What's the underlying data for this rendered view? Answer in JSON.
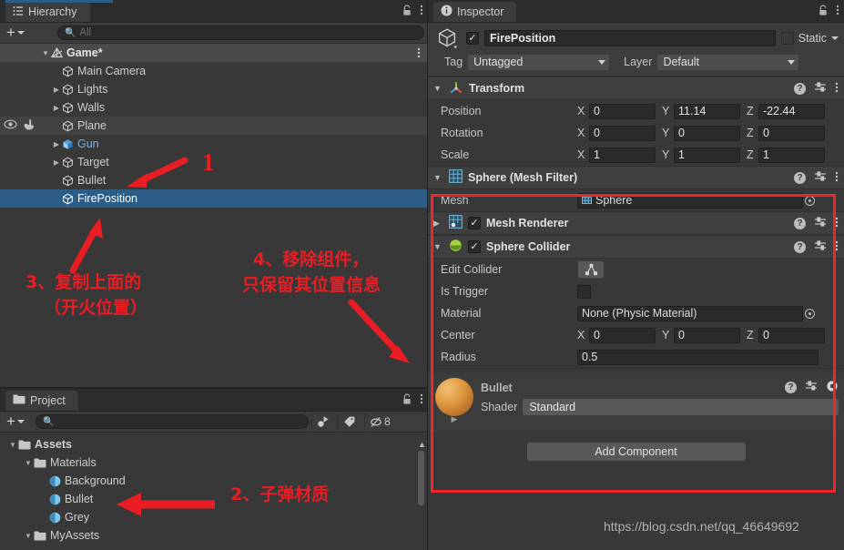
{
  "hierarchy": {
    "tab_label": "Hierarchy",
    "tab_icon": "hierarchy-list-icon",
    "create_label": "+",
    "search_placeholder": "All",
    "scene": {
      "name": "Game*",
      "icon": "unity-scene-icon"
    },
    "items": [
      {
        "label": "Main Camera",
        "indent": 2,
        "expandable": false,
        "selected": false,
        "hover": false,
        "blue": false
      },
      {
        "label": "Lights",
        "indent": 2,
        "expandable": true,
        "selected": false,
        "hover": false,
        "blue": false
      },
      {
        "label": "Walls",
        "indent": 2,
        "expandable": true,
        "selected": false,
        "hover": false,
        "blue": false
      },
      {
        "label": "Plane",
        "indent": 2,
        "expandable": false,
        "selected": false,
        "hover": true,
        "blue": false
      },
      {
        "label": "Gun",
        "indent": 2,
        "expandable": true,
        "selected": false,
        "hover": false,
        "blue": true
      },
      {
        "label": "Target",
        "indent": 2,
        "expandable": true,
        "selected": false,
        "hover": false,
        "blue": false
      },
      {
        "label": "Bullet",
        "indent": 2,
        "expandable": false,
        "selected": false,
        "hover": false,
        "blue": false
      },
      {
        "label": "FirePosition",
        "indent": 2,
        "expandable": false,
        "selected": true,
        "hover": false,
        "blue": false
      }
    ]
  },
  "project": {
    "tab_label": "Project",
    "tab_icon": "folder-icon",
    "create_label": "+",
    "search_placeholder": "",
    "tool_icons": [
      "favorites-icon",
      "label-icon",
      "hidden-packages-icon"
    ],
    "hidden_count": "8",
    "items": [
      {
        "label": "Assets",
        "indent": 0,
        "type": "folder",
        "expanded": true
      },
      {
        "label": "Materials",
        "indent": 1,
        "type": "folder",
        "expanded": true
      },
      {
        "label": "Background",
        "indent": 2,
        "type": "material",
        "expanded": false
      },
      {
        "label": "Bullet",
        "indent": 2,
        "type": "material",
        "expanded": false
      },
      {
        "label": "Grey",
        "indent": 2,
        "type": "material",
        "expanded": false
      },
      {
        "label": "MyAssets",
        "indent": 1,
        "type": "folder",
        "expanded": true
      }
    ]
  },
  "inspector": {
    "tab_label": "Inspector",
    "tab_icon": "info-icon",
    "gameobject": {
      "enabled": true,
      "name": "FirePosition",
      "static_label": "Static",
      "static_checked": false,
      "tag_label": "Tag",
      "tag_value": "Untagged",
      "layer_label": "Layer",
      "layer_value": "Default"
    },
    "transform": {
      "title": "Transform",
      "icon": "transform-axis-icon",
      "rows": [
        {
          "name": "Position",
          "x": "0",
          "y": "11.14",
          "z": "-22.44"
        },
        {
          "name": "Rotation",
          "x": "0",
          "y": "0",
          "z": "0"
        },
        {
          "name": "Scale",
          "x": "1",
          "y": "1",
          "z": "1"
        }
      ]
    },
    "mesh_filter": {
      "title": "Sphere (Mesh Filter)",
      "icon": "mesh-filter-icon",
      "mesh_label": "Mesh",
      "mesh_value": "Sphere"
    },
    "mesh_renderer": {
      "title": "Mesh Renderer",
      "icon": "mesh-renderer-icon",
      "enabled": true,
      "expanded": false
    },
    "sphere_collider": {
      "title": "Sphere Collider",
      "icon": "sphere-collider-icon",
      "enabled": true,
      "edit_collider_label": "Edit Collider",
      "is_trigger_label": "Is Trigger",
      "is_trigger_checked": false,
      "material_label": "Material",
      "material_value": "None (Physic Material)",
      "center_label": "Center",
      "center": {
        "x": "0",
        "y": "0",
        "z": "0"
      },
      "radius_label": "Radius",
      "radius_value": "0.5"
    },
    "material_preview": {
      "name": "Bullet",
      "shader_label": "Shader",
      "shader_value": "Standard",
      "ball_color": "#e09a3f"
    },
    "add_component_label": "Add Component"
  },
  "annotations": {
    "accent_color": "#ea1c24",
    "items": [
      {
        "id": "anno-1",
        "text": "1",
        "kind": "number"
      },
      {
        "id": "anno-2",
        "text": "2、子弹材质",
        "kind": "chinese"
      },
      {
        "id": "anno-3a",
        "text": "3、复制上面的",
        "kind": "chinese"
      },
      {
        "id": "anno-3b",
        "text": "（开火位置）",
        "kind": "chinese"
      },
      {
        "id": "anno-4a",
        "text": "4、移除组件，",
        "kind": "chinese"
      },
      {
        "id": "anno-4b",
        "text": "只保留其位置信息",
        "kind": "chinese"
      }
    ]
  },
  "watermark": {
    "text": "https://blog.csdn.net/qq_46649692"
  },
  "colors": {
    "panel_bg": "#383838",
    "tab_bg": "#3c3c3c",
    "selection_blue": "#2c5d87",
    "annotation_red": "#ea1c24",
    "text": "#c4c4c4"
  }
}
